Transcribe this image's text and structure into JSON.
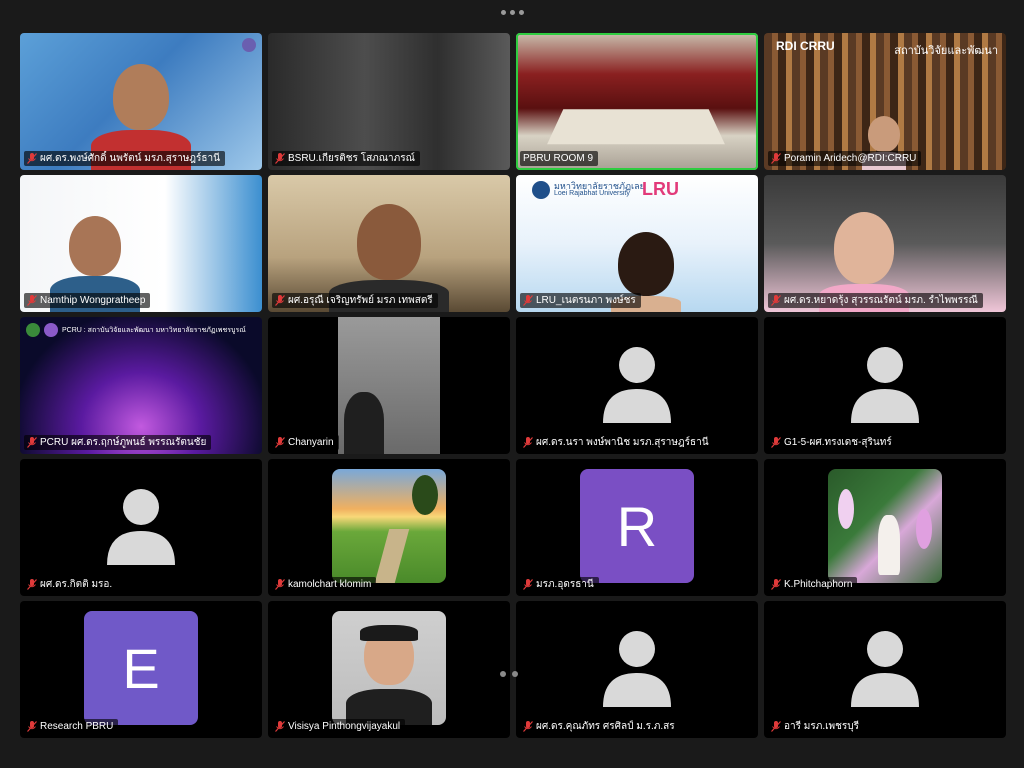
{
  "app": {
    "more_menu_icon": "ellipsis-icon",
    "pagination_icon": "page-dots-icon"
  },
  "colors": {
    "active_speaker": "#2ecc40",
    "avatar_R": "#7a4fc4",
    "avatar_E": "#7059c8",
    "generic_avatar": "#d9d9d9",
    "muted_mic": "#e03a3a"
  },
  "tiles": [
    {
      "name": "ผศ.ดร.พงษ์ศักดิ์ นพรัตน์ มรภ.สุราษฎร์ธานี",
      "muted": true,
      "kind": "video"
    },
    {
      "name": "BSRU.เกียรติชร โสภณาภรณ์",
      "muted": true,
      "kind": "video"
    },
    {
      "name": "PBRU ROOM 9",
      "muted": false,
      "kind": "video",
      "active": true
    },
    {
      "name": "Poramin Aridech@RDI:CRRU",
      "muted": true,
      "kind": "video",
      "overlay_title": "RDI CRRU",
      "overlay_subtitle": "สถาบันวิจัยและพัฒนา"
    },
    {
      "name": "Namthip Wongpratheep",
      "muted": true,
      "kind": "video"
    },
    {
      "name": "ผศ.อรุณี เจริญทรัพย์ มรภ เทพสตรี",
      "muted": true,
      "kind": "video"
    },
    {
      "name": "LRU_เนตรนภา พงษ์ชร",
      "muted": true,
      "kind": "video",
      "overlay_title": "LRU",
      "overlay_subtitle": "มหาวิทยาลัยราชภัฏเลย",
      "overlay_subtitle2": "Loei Rajabhat University"
    },
    {
      "name": "ผศ.ดร.หยาดรุ้ง สุวรรณรัตน์ มรภ. รำไพพรรณี",
      "muted": true,
      "kind": "video"
    },
    {
      "name": "PCRU ผศ.ดร.ฤกษ์ภูพนธ์ พรรณรัตนชัย",
      "muted": true,
      "kind": "video",
      "overlay_title": "PCRU : สถาบันวิจัยและพัฒนา มหาวิทยาลัยราชภัฏเพชรบูรณ์"
    },
    {
      "name": "Chanyarin",
      "muted": true,
      "kind": "video"
    },
    {
      "name": "ผศ.ดร.นรา พงษ์พานิช มรภ.สุราษฎร์ธานี",
      "muted": true,
      "kind": "generic"
    },
    {
      "name": "G1-5-ผศ.ทรงเดช-สุรินทร์",
      "muted": true,
      "kind": "generic"
    },
    {
      "name": "ผศ.ดร.กิตติ มรอ.",
      "muted": true,
      "kind": "generic"
    },
    {
      "name": "kamolchart klomim",
      "muted": true,
      "kind": "photo",
      "photo": "landscape"
    },
    {
      "name": "มรภ.อุดรธานี",
      "muted": true,
      "kind": "letter",
      "letter": "R"
    },
    {
      "name": "K.Phitchaphorn",
      "muted": true,
      "kind": "photo",
      "photo": "flowers"
    },
    {
      "name": "Research PBRU",
      "muted": true,
      "kind": "letter",
      "letter": "E"
    },
    {
      "name": "Visisya Pinthongvijayakul",
      "muted": true,
      "kind": "photo",
      "photo": "portrait"
    },
    {
      "name": "ผศ.ดร.คุณภัทร ศรศิลป์ ม.ร.ภ.สร",
      "muted": true,
      "kind": "generic"
    },
    {
      "name": "อารี มรภ.เพชรบุรี",
      "muted": true,
      "kind": "generic"
    }
  ]
}
